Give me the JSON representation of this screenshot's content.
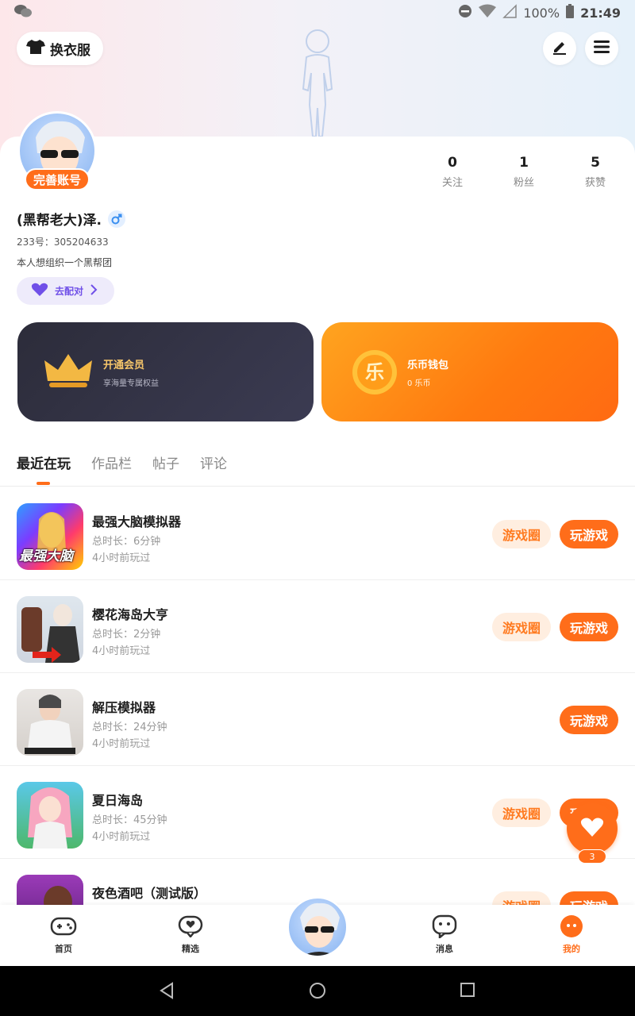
{
  "status_bar": {
    "battery": "100%",
    "time": "21:49"
  },
  "header": {
    "outfit_label": "换衣服"
  },
  "profile": {
    "badge": "完善账号",
    "nickname": "(黑帮老大)泽.",
    "uid": "233号：305204633",
    "bio": "本人想组织一个黑帮团",
    "match_label": "去配对"
  },
  "stats": [
    {
      "value": "0",
      "label": "关注"
    },
    {
      "value": "1",
      "label": "粉丝"
    },
    {
      "value": "5",
      "label": "获赞"
    }
  ],
  "cards": {
    "vip": {
      "title": "开通会员",
      "sub": "享海量专属权益"
    },
    "wallet": {
      "title": "乐币钱包",
      "sub": "0 乐币",
      "coin_glyph": "乐"
    }
  },
  "tabs": [
    "最近在玩",
    "作品栏",
    "帖子",
    "评论"
  ],
  "games": [
    {
      "name": "最强大脑模拟器",
      "duration": "总时长：6分钟",
      "ago": "4小时前玩过",
      "circle": "游戏圈",
      "play": "玩游戏",
      "thumb_text": "最强大脑"
    },
    {
      "name": "樱花海岛大亨",
      "duration": "总时长：2分钟",
      "ago": "4小时前玩过",
      "circle": "游戏圈",
      "play": "玩游戏"
    },
    {
      "name": "解压模拟器",
      "duration": "总时长：24分钟",
      "ago": "4小时前玩过",
      "circle": "",
      "play": "玩游戏"
    },
    {
      "name": "夏日海岛",
      "duration": "总时长：45分钟",
      "ago": "4小时前玩过",
      "circle": "游戏圈",
      "play": "玩游戏"
    },
    {
      "name": "夜色酒吧（测试版）",
      "duration": "",
      "ago": "",
      "circle": "游戏圈",
      "play": "玩游戏"
    }
  ],
  "like_fab": {
    "count": "3"
  },
  "bottom_nav": [
    {
      "label": "首页",
      "icon": "gamepad-icon"
    },
    {
      "label": "精选",
      "icon": "heart-chat-icon"
    },
    {
      "label": "",
      "icon": "avatar"
    },
    {
      "label": "消息",
      "icon": "message-icon"
    },
    {
      "label": "我的",
      "icon": "profile-face-icon"
    }
  ],
  "colors": {
    "accent": "#ff6d1a",
    "vip_card": "#2c2c3a",
    "wallet_card": "#ff8a14",
    "match": "#7050e8"
  }
}
